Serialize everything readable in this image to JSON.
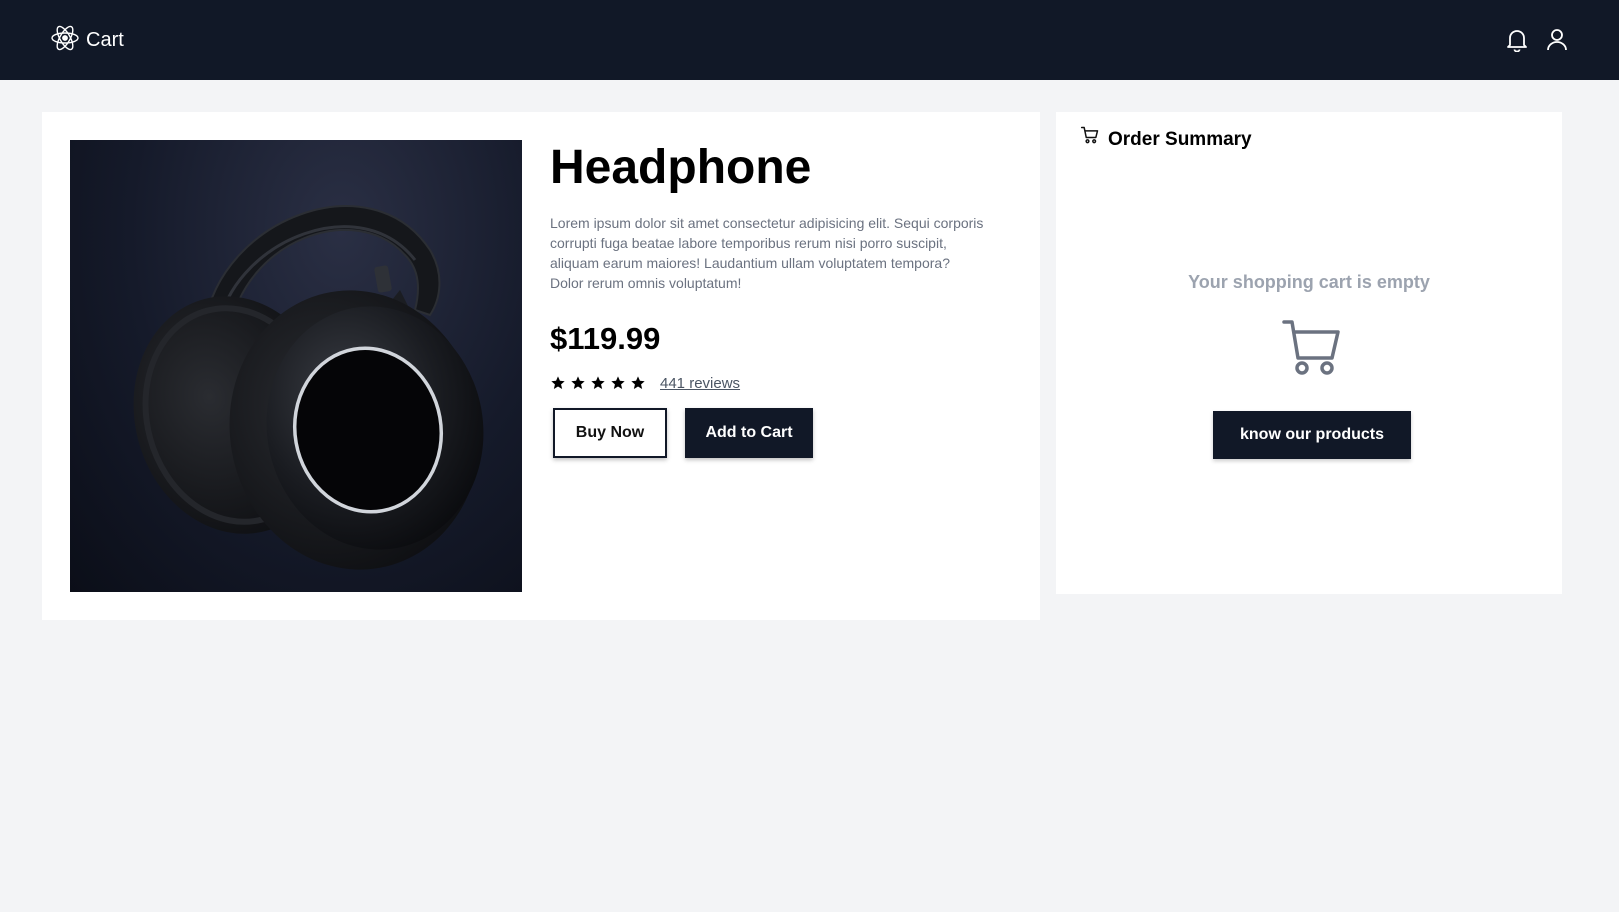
{
  "header": {
    "brand_label": "Cart",
    "logo_icon": "react-atom-icon",
    "icons": [
      "bell-icon",
      "user-icon"
    ],
    "background": "#111827"
  },
  "product": {
    "title": "Headphone",
    "description": "Lorem ipsum dolor sit amet consectetur adipisicing elit. Sequi corporis corrupti fuga beatae labore temporibus rerum nisi porro suscipit, aliquam earum maiores! Laudantium ullam voluptatem tempora? Dolor rerum omnis voluptatum!",
    "price": "$119.99",
    "rating": 5,
    "rating_max": 5,
    "reviews_label": "441 reviews",
    "buy_now_label": "Buy Now",
    "add_to_cart_label": "Add to Cart",
    "image_alt": "black over-ear headphones"
  },
  "summary": {
    "title": "Order Summary",
    "empty_text": "Your shopping cart is empty",
    "cta_label": "know our products",
    "empty_icon_color": "#6b7280"
  }
}
